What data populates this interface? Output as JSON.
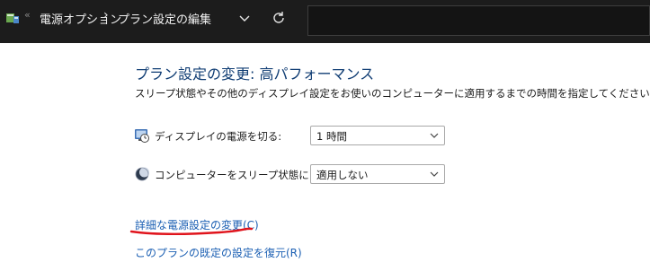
{
  "address_bar": {
    "breadcrumb_overflow": "«",
    "crumb_1": "電源オプション",
    "separator": "›",
    "crumb_2": "プラン設定の編集"
  },
  "main": {
    "title": "プラン設定の変更: 高パフォーマンス",
    "description": "スリープ状態やその他のディスプレイ設定をお使いのコンピューターに適用するまでの時間を指定してください。",
    "settings": [
      {
        "label": "ディスプレイの電源を切る:",
        "value": "1 時間",
        "icon": "display-timer-icon"
      },
      {
        "label": "コンピューターをスリープ状態にする:",
        "value": "適用しない",
        "icon": "sleep-moon-icon"
      }
    ],
    "links": {
      "advanced": "詳細な電源設定の変更(C)",
      "restore": "このプランの既定の設定を復元(R)"
    }
  },
  "colors": {
    "topbar_bg": "#1c1c1c",
    "title": "#0f3c73",
    "link": "#1b5fb3",
    "annotation": "#e0141c"
  }
}
